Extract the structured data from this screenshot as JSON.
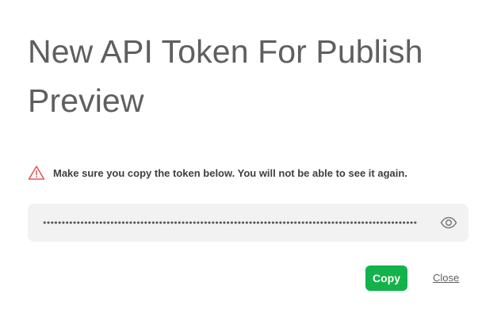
{
  "dialog": {
    "title": "New API Token For Publish Preview",
    "warning": {
      "icon": "warning-triangle-icon",
      "icon_color": "#e05a5a",
      "text": "Make sure you copy the token below. You will not be able to see it again."
    },
    "token": {
      "masked_value": "••••••••••••••••••••••••••••••••••••••••••••••••••••••••••••••••••••••••••••••••••••••••••••••••••••",
      "visibility_icon": "eye-icon"
    },
    "actions": {
      "copy_label": "Copy",
      "copy_color": "#13b24a",
      "close_label": "Close"
    }
  }
}
